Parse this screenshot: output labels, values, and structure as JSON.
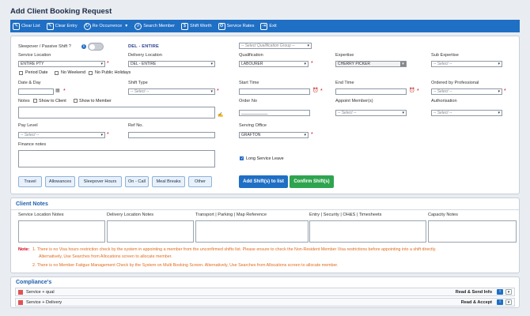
{
  "page_title": "Add Client Booking Request",
  "toolbar": {
    "clear_list": "Clear List",
    "clear_entry": "Clear Entry",
    "re_occurrence": "Re Occurrence",
    "search_member": "Search Member",
    "shift_worth": "Shift Worth",
    "service_rates": "Service Rates",
    "exit": "Exit"
  },
  "form": {
    "sleepover_label": "Sleepover / Passive Shift ?",
    "del_entire": "DEL - ENTIRE",
    "qualification_group": {
      "placeholder": "-- Select Qualification Group --"
    },
    "service_location": {
      "label": "Service Location",
      "value": "ENTIRE PTY"
    },
    "delivery_location": {
      "label": "Delivery Location",
      "value": "DEL - ENTIRE"
    },
    "qualification": {
      "label": "Qualification",
      "value": "LABOURER"
    },
    "expertise": {
      "label": "Expertise",
      "value": "CHERRY PICKER"
    },
    "sub_expertise": {
      "label": "Sub Expertise",
      "value": "-- Select --"
    },
    "period_date": "Period Date",
    "no_weekend": "No Weekend",
    "no_public_holidays": "No Public Holidays",
    "date_day": {
      "label": "Date & Day"
    },
    "shift_type": {
      "label": "Shift Type",
      "value": "-- Select --"
    },
    "start_time": {
      "label": "Start Time"
    },
    "end_time": {
      "label": "End Time"
    },
    "ordered_by": {
      "label": "Ordered by Professional",
      "value": "-- Select --"
    },
    "notes": "Notes",
    "show_to_client": "Show to Client",
    "show_to_member": "Show to Member",
    "order_no": {
      "label": "Order No",
      "value": "____________"
    },
    "appoint_members": {
      "label": "Appoint Member(s)",
      "value": "-- Select --"
    },
    "authorisation": {
      "label": "Authorisation",
      "value": "-- Select --"
    },
    "pay_level": {
      "label": "Pay Level",
      "value": "-- Select --"
    },
    "ref_no": {
      "label": "Ref No."
    },
    "serving_office": {
      "label": "Serving Office",
      "value": "GRAFTON"
    },
    "finance_notes": "Finance notes",
    "long_service_leave": "Long Service Leave"
  },
  "buttons": {
    "travel": "Travel",
    "allowances": "Allowances",
    "sleepover_hours": "Sleepover Hours",
    "on_call": "On - Call",
    "meal_breaks": "Meal Breaks",
    "other": "Other",
    "add_shifts": "Add Shift(s) to list",
    "confirm_shifts": "Confirm Shift(s)"
  },
  "client_notes": {
    "title": "Client Notes",
    "columns": [
      "Service Location Notes",
      "Delivery Location Notes",
      "Transport | Parking | Map Reference",
      "Entry | Security | OH&S | Timesheets",
      "Capacity Notes"
    ],
    "note_label": "Note:",
    "note1_a": "1. There is no Visa hours restriction check by the system in appointing a member from the unconfirmed shifts list. Please ensure to check the Non-Resident Member Visa restrictions before appointing into a shift directly.",
    "note1_b": "Alternatively, Use Searches from Allocations screen to allocate member.",
    "note2": "2. There is no Member Fatigue Management Check by the System on Multi Booking Screen. Alternatively, Use Searches from Allocations screen to allocate member."
  },
  "compliance": {
    "title": "Compliance's",
    "rows": [
      {
        "label": "Service + qual",
        "action": "Read & Send Info"
      },
      {
        "label": "Service + Delivery",
        "action": "Read & Accept"
      }
    ]
  },
  "colors": {
    "toolbar": "#1f6fc4",
    "primary_button": "#1f6fc4",
    "confirm_button": "#2ea44f",
    "note_text": "#e06a1a"
  }
}
